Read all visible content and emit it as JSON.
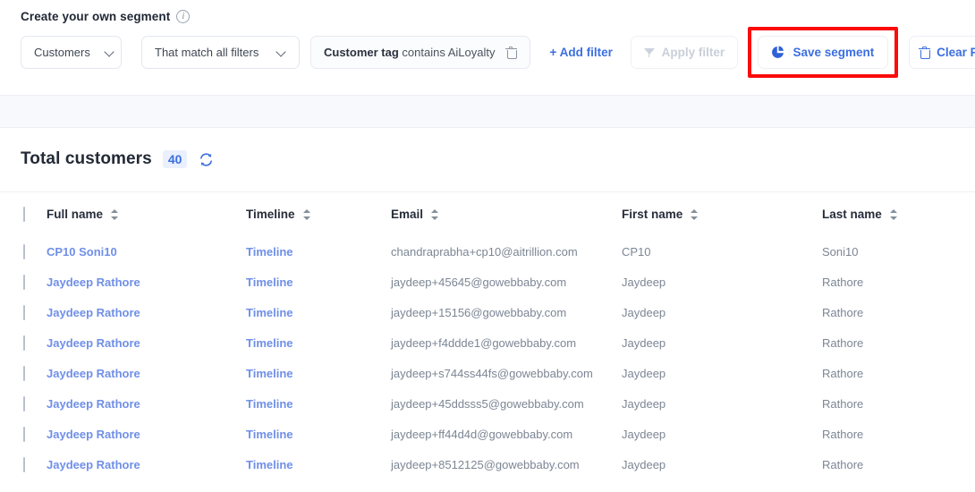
{
  "segment_panel": {
    "title": "Create your own segment",
    "info_icon": "info-icon",
    "audience_select": {
      "value": "Customers",
      "chevron": "chevron-down-icon"
    },
    "match_select": {
      "value": "That match all filters",
      "chevron": "chevron-down-icon"
    },
    "filter_chip": {
      "key": "Customer tag",
      "rest": "contains AiLoyalty",
      "delete_icon": "trash-icon"
    },
    "add_filter_label": "+ Add filter",
    "apply_filter": {
      "label": "Apply filter",
      "icon": "funnel-icon",
      "disabled": true
    },
    "save_segment": {
      "label": "Save segment",
      "icon": "pie-chart-icon",
      "highlighted": true
    },
    "clear_filter": {
      "label": "Clear Filter",
      "icon": "trash-icon"
    },
    "highlight_color": "#fb0b0b",
    "accent_color": "#3b6fe0"
  },
  "totals": {
    "label": "Total customers",
    "count": "40",
    "refresh_icon": "refresh-icon"
  },
  "table": {
    "columns": [
      {
        "label": "Full name",
        "sortable": true
      },
      {
        "label": "Timeline",
        "sortable": true
      },
      {
        "label": "Email",
        "sortable": true
      },
      {
        "label": "First name",
        "sortable": true
      },
      {
        "label": "Last name",
        "sortable": true
      }
    ],
    "rows": [
      {
        "full_name": "CP10 Soni10",
        "timeline": "Timeline",
        "email": "chandraprabha+cp10@aitrillion.com",
        "first_name": "CP10",
        "last_name": "Soni10"
      },
      {
        "full_name": "Jaydeep Rathore",
        "timeline": "Timeline",
        "email": "jaydeep+45645@gowebbaby.com",
        "first_name": "Jaydeep",
        "last_name": "Rathore"
      },
      {
        "full_name": "Jaydeep Rathore",
        "timeline": "Timeline",
        "email": "jaydeep+15156@gowebbaby.com",
        "first_name": "Jaydeep",
        "last_name": "Rathore"
      },
      {
        "full_name": "Jaydeep Rathore",
        "timeline": "Timeline",
        "email": "jaydeep+f4ddde1@gowebbaby.com",
        "first_name": "Jaydeep",
        "last_name": "Rathore"
      },
      {
        "full_name": "Jaydeep Rathore",
        "timeline": "Timeline",
        "email": "jaydeep+s744ss44fs@gowebbaby.com",
        "first_name": "Jaydeep",
        "last_name": "Rathore"
      },
      {
        "full_name": "Jaydeep Rathore",
        "timeline": "Timeline",
        "email": "jaydeep+45ddsss5@gowebbaby.com",
        "first_name": "Jaydeep",
        "last_name": "Rathore"
      },
      {
        "full_name": "Jaydeep Rathore",
        "timeline": "Timeline",
        "email": "jaydeep+ff44d4d@gowebbaby.com",
        "first_name": "Jaydeep",
        "last_name": "Rathore"
      },
      {
        "full_name": "Jaydeep Rathore",
        "timeline": "Timeline",
        "email": "jaydeep+8512125@gowebbaby.com",
        "first_name": "Jaydeep",
        "last_name": "Rathore"
      }
    ]
  }
}
